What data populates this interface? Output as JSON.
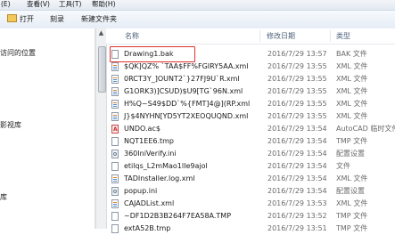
{
  "menu": [
    "(E)",
    "查看(V)",
    "工具(T)",
    "帮助(H)"
  ],
  "toolbar": {
    "open_label": "打开",
    "burn_label": "刻录",
    "new_folder_label": "新建文件夹"
  },
  "nav": {
    "items": [
      "访问的位置",
      "影视库",
      "库"
    ]
  },
  "columns": {
    "name": "名称",
    "date": "修改日期",
    "type": "类型"
  },
  "files": [
    {
      "name": "Drawing1.bak",
      "date": "2016/7/29 13:57",
      "type": "BAK 文件",
      "icon": "file-icon",
      "selected": true
    },
    {
      "name": "$QK]QZ% `TAA$FF%FGIRY5AA.xml",
      "date": "2016/7/29 13:55",
      "type": "XML 文件",
      "icon": "xml"
    },
    {
      "name": "0RCT3Y_]OUNT2`}27FJ9U`R.xml",
      "date": "2016/7/29 13:55",
      "type": "XML 文件",
      "icon": "xml"
    },
    {
      "name": "G1ORK3)]CSUD)$U9[TG`96N.xml",
      "date": "2016/7/29 13:55",
      "type": "XML 文件",
      "icon": "xml"
    },
    {
      "name": "H%Q~S49$DD`%{FMT]4@](RP.xml",
      "date": "2016/7/29 13:55",
      "type": "XML 文件",
      "icon": "xml"
    },
    {
      "name": "J}$4NYHN[YD5YT2XEOQUQND.xml",
      "date": "2016/7/29 13:55",
      "type": "XML 文件",
      "icon": "xml"
    },
    {
      "name": "UNDO.ac$",
      "date": "2016/7/29 13:54",
      "type": "AutoCAD 临时文件",
      "icon": "dwg"
    },
    {
      "name": "NQT1EE6.tmp",
      "date": "2016/7/29 13:54",
      "type": "TMP 文件",
      "icon": "file-icon"
    },
    {
      "name": "360IniVerify.ini",
      "date": "2016/7/29 13:54",
      "type": "配置设置",
      "icon": "cfg"
    },
    {
      "name": "etilqs_L2mMao1lIe9ajol",
      "date": "2016/7/29 13:54",
      "type": "文件",
      "icon": "file-icon"
    },
    {
      "name": "TADInstaller.log.xml",
      "date": "2016/7/29 13:54",
      "type": "XML 文件",
      "icon": "xml"
    },
    {
      "name": "popup.ini",
      "date": "2016/7/29 13:54",
      "type": "配置设置",
      "icon": "cfg"
    },
    {
      "name": "CAJADList.xml",
      "date": "2016/7/29 13:53",
      "type": "XML 文件",
      "icon": "xml"
    },
    {
      "name": "~DF1D2B3B264F7EA58A.TMP",
      "date": "2016/7/29 13:52",
      "type": "TMP 文件",
      "icon": "file-icon"
    },
    {
      "name": "extA52B.tmp",
      "date": "2016/7/29 13:51",
      "type": "TMP 文件",
      "icon": "file-icon"
    }
  ]
}
